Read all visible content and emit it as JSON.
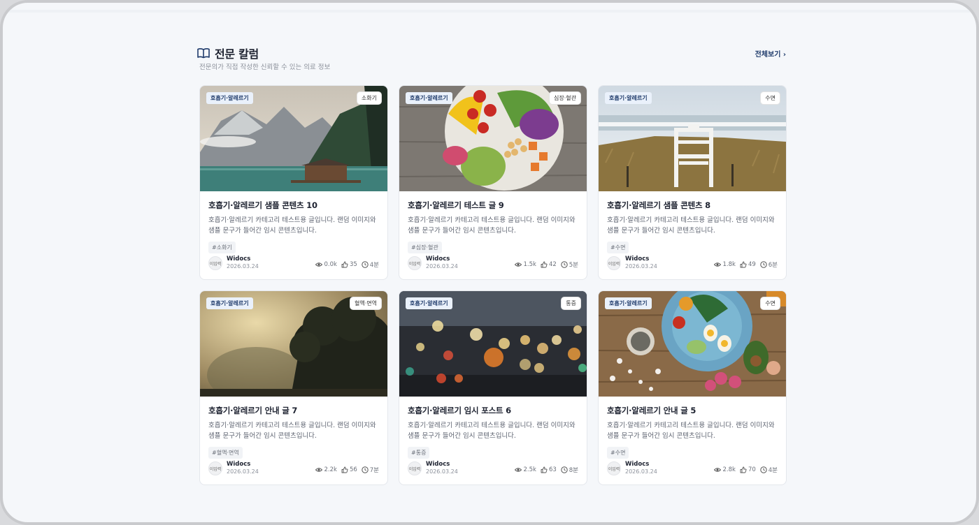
{
  "section": {
    "icon": "book-icon",
    "title": "전문 칼럼",
    "subtitle": "전문의가 직접 작성한 신뢰할 수 있는 의료 정보",
    "view_all": "전체보기 ›"
  },
  "cards": [
    {
      "category": "호흡기·알레르기",
      "tag_badge": "소화기",
      "title": "호흡기·알레르기 샘플 콘텐츠 10",
      "desc": "호흡기·알레르기 카테고리 테스트용 글입니다. 랜덤 이미지와 샘플 문구가 들어간 임시 콘텐츠입니다.",
      "chip": "#소화기",
      "avatar": "이입력",
      "author": "Widocs",
      "date": "2026.03.24",
      "views": "0.0k",
      "likes": "35",
      "read_time": "4분",
      "image": "mountain-lake"
    },
    {
      "category": "호흡기·알레르기",
      "tag_badge": "심장·혈관",
      "title": "호흡기·알레르기 테스트 글 9",
      "desc": "호흡기·알레르기 카테고리 테스트용 글입니다. 랜덤 이미지와 샘플 문구가 들어간 임시 콘텐츠입니다.",
      "chip": "#심장·혈관",
      "avatar": "이입력",
      "author": "Widocs",
      "date": "2026.03.24",
      "views": "1.5k",
      "likes": "42",
      "read_time": "5분",
      "image": "salad-bowl"
    },
    {
      "category": "호흡기·알레르기",
      "tag_badge": "수면",
      "title": "호흡기·알레르기 샘플 콘텐츠 8",
      "desc": "호흡기·알레르기 카테고리 테스트용 글입니다. 랜덤 이미지와 샘플 문구가 들어간 임시 콘텐츠입니다.",
      "chip": "#수면",
      "avatar": "이입력",
      "author": "Widocs",
      "date": "2026.03.24",
      "views": "1.8k",
      "likes": "49",
      "read_time": "6분",
      "image": "beach-chair"
    },
    {
      "category": "호흡기·알레르기",
      "tag_badge": "혈액·면역",
      "title": "호흡기·알레르기 안내 글 7",
      "desc": "호흡기·알레르기 카테고리 테스트용 글입니다. 랜덤 이미지와 샘플 문구가 들어간 임시 콘텐츠입니다.",
      "chip": "#혈액·면역",
      "avatar": "이입력",
      "author": "Widocs",
      "date": "2026.03.24",
      "views": "2.2k",
      "likes": "56",
      "read_time": "7분",
      "image": "foggy-tree"
    },
    {
      "category": "호흡기·알레르기",
      "tag_badge": "통증",
      "title": "호흡기·알레르기 임시 포스트 6",
      "desc": "호흡기·알레르기 카테고리 테스트용 글입니다. 랜덤 이미지와 샘플 문구가 들어간 임시 콘텐츠입니다.",
      "chip": "#통증",
      "avatar": "이입력",
      "author": "Widocs",
      "date": "2026.03.24",
      "views": "2.5k",
      "likes": "63",
      "read_time": "8분",
      "image": "bokeh-lights"
    },
    {
      "category": "호흡기·알레르기",
      "tag_badge": "수면",
      "title": "호흡기·알레르기 안내 글 5",
      "desc": "호흡기·알레르기 카테고리 테스트용 글입니다. 랜덤 이미지와 샘플 문구가 들어간 임시 콘텐츠입니다.",
      "chip": "#수면",
      "avatar": "이입력",
      "author": "Widocs",
      "date": "2026.03.24",
      "views": "2.8k",
      "likes": "70",
      "read_time": "4분",
      "image": "food-table"
    }
  ],
  "colors": {
    "accent": "#1f3b6b",
    "badge_bg": "#eaf1fb",
    "page_bg": "#f5f7fa"
  }
}
